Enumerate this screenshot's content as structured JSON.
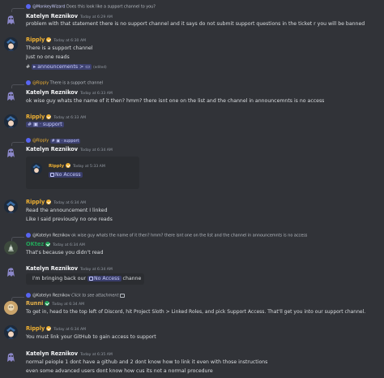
{
  "messages": [
    {
      "reply_user": "@MonkeyWizard",
      "reply_text": "Does this look like a support channel to you?",
      "author": "Katelyn Reznikov",
      "ts": "Today at 6:29 AM",
      "lines": [
        "problem with that statement there is no support channel and it says do not submit support questions in the ticket r you will be banned"
      ]
    },
    {
      "author": "Ripply",
      "ts": "Today at 6:30 AM",
      "lines": [
        "There is a support channel",
        "Just no one reads"
      ],
      "mention_prefix": "#",
      "mention": "announcements >",
      "edited": "(edited)"
    },
    {
      "reply_user": "@Ripply",
      "reply_text": "There is a support channel",
      "author": "Katelyn Reznikov",
      "ts": "Today at 6:33 AM",
      "lines": [
        "ok wise guy whats the name of it then? hmm? there isnt one on the list and the channel in announcemnts is no access"
      ]
    },
    {
      "author": "Ripply",
      "ts": "Today at 6:33 AM",
      "mention": "support"
    },
    {
      "reply_user": "@Ripply",
      "reply_text": "support",
      "author": "Katelyn Reznikov",
      "ts": "Today at 6:34 AM",
      "embed_ts": "Today at 5:33 AM",
      "embed_mention": "No Access"
    },
    {
      "author": "Ripply",
      "ts": "Today at 6:34 AM",
      "lines": [
        "Read the announcement I linked",
        "Like I said previously no one reads"
      ]
    },
    {
      "reply_user": "@Katelyn Reznikov",
      "reply_text": "ok wise guy whats the name of it then? hmm? there isnt one on the list and the channel in announcemnts is no access",
      "author": "OKtez",
      "ts": "Today at 6:34 AM",
      "lines": [
        "That's because you didn't read"
      ]
    },
    {
      "author": "Katelyn Reznikov",
      "ts": "Today at 6:34 AM",
      "lines": [
        "I'm bringing back our"
      ],
      "mention": "No Access",
      "trail": "channe"
    },
    {
      "reply_user": "@Katelyn Reznikov",
      "reply_text": "Click to see attachment",
      "author": "Runni",
      "ts": "Today at 6:34 AM",
      "lines": [
        "To get in, head to the top left of Discord, hit Project Sloth > Linked Roles, and pick Support Access. That'll get you into our support channel."
      ]
    },
    {
      "author": "Ripply",
      "ts": "Today at 6:34 AM",
      "lines": [
        "You must link your GitHub to gain access to support"
      ]
    },
    {
      "author": "Katelyn Reznikov",
      "ts": "Today at 6:35 AM",
      "lines": [
        "normal peiople 1 dont have a github and 2 dont know how to link it even with those instructions",
        "even some advanced users dont know how cus its not a normal procedure"
      ]
    }
  ]
}
